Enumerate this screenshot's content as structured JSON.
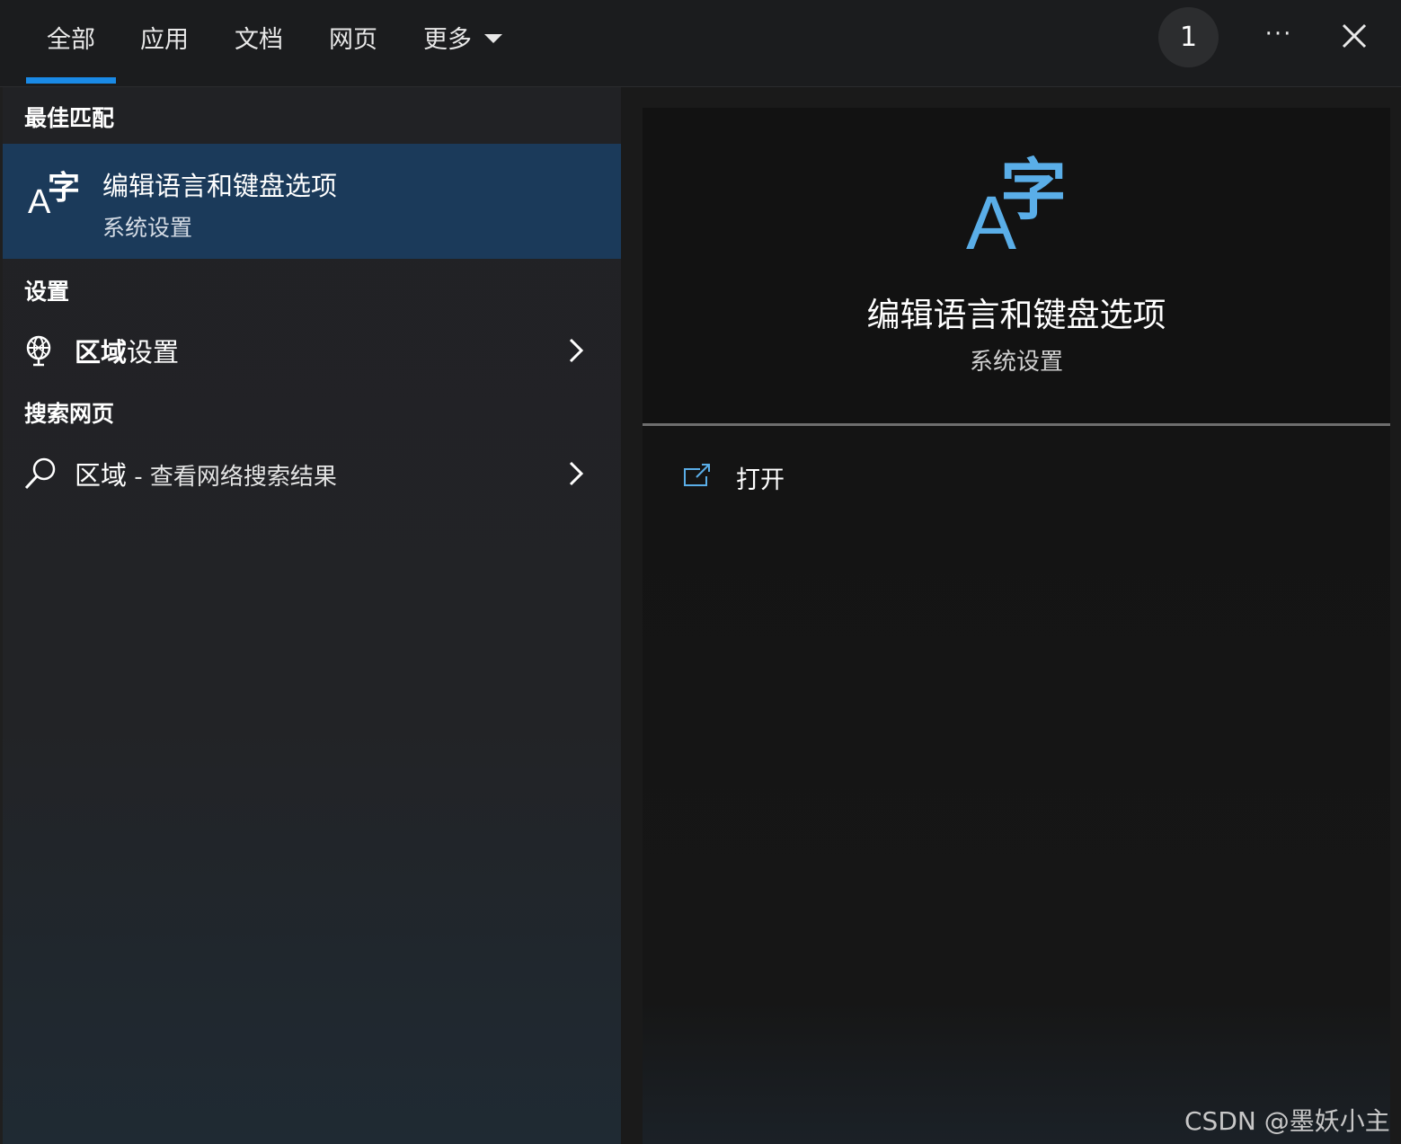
{
  "tabs": [
    {
      "label": "全部"
    },
    {
      "label": "应用"
    },
    {
      "label": "文档"
    },
    {
      "label": "网页"
    },
    {
      "label": "更多"
    }
  ],
  "header": {
    "badge_count": "1",
    "more_label": "···"
  },
  "results": {
    "best_match_heading": "最佳匹配",
    "best_match": {
      "title": "编辑语言和键盘选项",
      "subtitle": "系统设置",
      "icon_text_a": "A",
      "icon_text_zi": "字"
    },
    "settings_heading": "设置",
    "settings_item": {
      "label_bold": "区域",
      "label_rest": "设置"
    },
    "web_heading": "搜索网页",
    "web_item": {
      "query": "区域",
      "suffix": " - 查看网络搜索结果"
    }
  },
  "detail": {
    "icon_text_a": "A",
    "icon_text_zi": "字",
    "title": "编辑语言和键盘选项",
    "subtitle": "系统设置",
    "actions": [
      {
        "label": "打开",
        "icon": "open-external-icon"
      }
    ]
  },
  "watermark": "CSDN @墨妖小主",
  "colors": {
    "accent": "#1a8ae6",
    "selected_bg": "#1b3a5a",
    "icon_blue": "#5aaee8"
  }
}
